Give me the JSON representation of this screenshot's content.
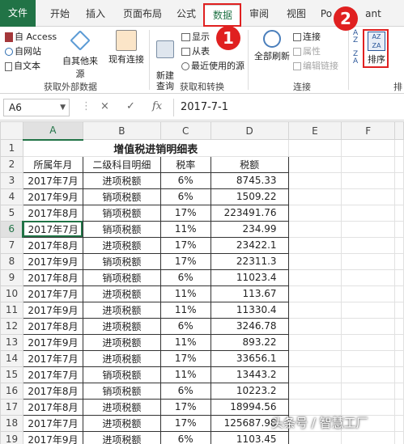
{
  "tabs": [
    "文件",
    "开始",
    "插入",
    "页面布局",
    "公式",
    "数据",
    "审阅",
    "视图",
    "Po",
    "ant"
  ],
  "ribbon": {
    "get_external": {
      "items": [
        "自 Access",
        "自网站",
        "自文本"
      ],
      "from_other": "自其他来源",
      "existing": "现有连接",
      "label": "获取外部数据"
    },
    "get_transform": {
      "new_query": "新建\n查询",
      "items": [
        "显示",
        "从表",
        "最近使用的源"
      ],
      "label": "获取和转换"
    },
    "connections": {
      "refresh_all": "全部刷新",
      "items": [
        "连接",
        "属性",
        "编辑链接"
      ],
      "label": "连接"
    },
    "sort": {
      "label": "排序",
      "az": "A\nZ",
      "za": "Z\nA",
      "group_label": "排"
    }
  },
  "formula_bar": {
    "name_box": "A6",
    "cancel": "×",
    "enter": "✓",
    "fx": "fx",
    "formula": "2017-7-1"
  },
  "columns": [
    "A",
    "B",
    "C",
    "D",
    "E",
    "F"
  ],
  "sheet": {
    "title": "增值税进销明细表",
    "headers": [
      "所属年月",
      "二级科目明细",
      "税率",
      "税额"
    ],
    "rows": [
      [
        "2017年7月",
        "进项税额",
        "6%",
        "8745.33"
      ],
      [
        "2017年9月",
        "销项税额",
        "6%",
        "1509.22"
      ],
      [
        "2017年8月",
        "销项税额",
        "17%",
        "223491.76"
      ],
      [
        "2017年7月",
        "销项税额",
        "11%",
        "234.99"
      ],
      [
        "2017年8月",
        "进项税额",
        "17%",
        "23422.1"
      ],
      [
        "2017年9月",
        "销项税额",
        "17%",
        "22311.3"
      ],
      [
        "2017年8月",
        "销项税额",
        "6%",
        "11023.4"
      ],
      [
        "2017年7月",
        "进项税额",
        "11%",
        "113.67"
      ],
      [
        "2017年9月",
        "进项税额",
        "11%",
        "11330.4"
      ],
      [
        "2017年8月",
        "进项税额",
        "6%",
        "3246.78"
      ],
      [
        "2017年9月",
        "进项税额",
        "11%",
        "893.22"
      ],
      [
        "2017年7月",
        "进项税额",
        "17%",
        "33656.1"
      ],
      [
        "2017年7月",
        "销项税额",
        "11%",
        "13443.2"
      ],
      [
        "2017年8月",
        "销项税额",
        "6%",
        "10223.2"
      ],
      [
        "2017年8月",
        "进项税额",
        "17%",
        "18994.56"
      ],
      [
        "2017年7月",
        "进项税额",
        "17%",
        "125687.98"
      ],
      [
        "2017年9月",
        "进项税额",
        "6%",
        "1103.45"
      ],
      [
        "2017年9月",
        "销项税额",
        "11%",
        "11033.5"
      ]
    ]
  },
  "annotations": {
    "badge1": "1",
    "badge2": "2"
  },
  "watermark": "头条号 / 智慧工厂",
  "colors": {
    "excel_green": "#217346",
    "annotation_red": "#e02020"
  }
}
